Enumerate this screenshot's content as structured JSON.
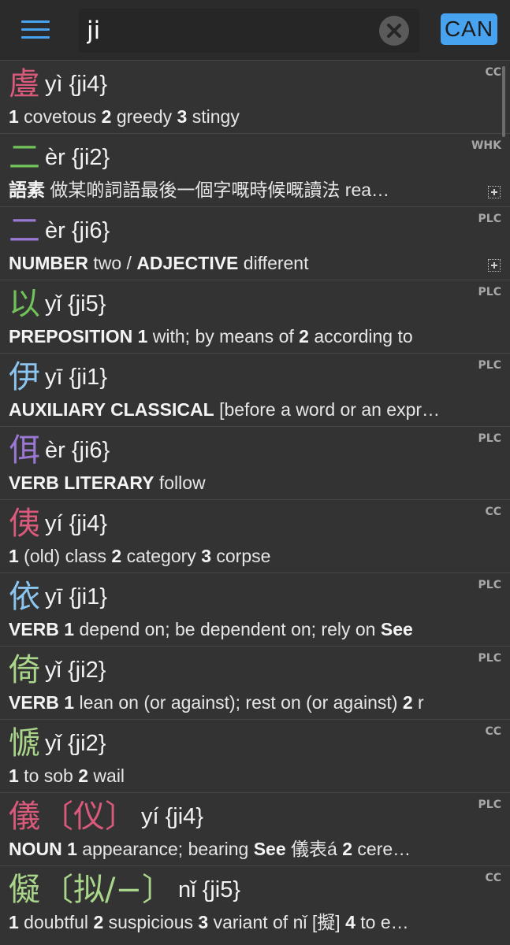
{
  "search": {
    "query": "ji"
  },
  "lang_button": "CAN",
  "results": [
    {
      "char": "䖒",
      "variant": "",
      "romanization": "yì {ji4}",
      "source": "CC",
      "definition": [
        {
          "t": "1",
          "b": true
        },
        {
          "t": " covetous  "
        },
        {
          "t": "2",
          "b": true
        },
        {
          "t": " greedy  "
        },
        {
          "t": "3",
          "b": true
        },
        {
          "t": " stingy"
        }
      ],
      "expandable": false
    },
    {
      "char": "二",
      "variant": "",
      "romanization": "èr {ji2}",
      "source": "WHK",
      "definition": [
        {
          "t": "語素",
          "b": true
        },
        {
          "t": "  做某啲詞語最後一個字嘅時候嘅讀法  rea…"
        }
      ],
      "expandable": true
    },
    {
      "char": "二",
      "variant": "",
      "romanization": "èr {ji6}",
      "source": "PLC",
      "definition": [
        {
          "t": "NUMBER",
          "b": true
        },
        {
          "t": " two /  "
        },
        {
          "t": "ADJECTIVE",
          "b": true
        },
        {
          "t": " different"
        }
      ],
      "expandable": true
    },
    {
      "char": "以",
      "variant": "",
      "romanization": "yǐ {ji5}",
      "source": "PLC",
      "definition": [
        {
          "t": "PREPOSITION",
          "b": true
        },
        {
          "t": "  "
        },
        {
          "t": "1",
          "b": true
        },
        {
          "t": " with; by means of  "
        },
        {
          "t": "2",
          "b": true
        },
        {
          "t": " according to"
        }
      ],
      "expandable": false
    },
    {
      "char": "伊",
      "variant": "",
      "romanization": "yī {ji1}",
      "source": "PLC",
      "definition": [
        {
          "t": "AUXILIARY  CLASSICAL",
          "b": true
        },
        {
          "t": " [before a word or an expr…"
        }
      ],
      "expandable": false
    },
    {
      "char": "佴",
      "variant": "",
      "romanization": "èr {ji6}",
      "source": "PLC",
      "definition": [
        {
          "t": "VERB  LITERARY",
          "b": true
        },
        {
          "t": " follow"
        }
      ],
      "expandable": false
    },
    {
      "char": "侇",
      "variant": "",
      "romanization": "yí {ji4}",
      "source": "CC",
      "definition": [
        {
          "t": "1",
          "b": true
        },
        {
          "t": " (old) class  "
        },
        {
          "t": "2",
          "b": true
        },
        {
          "t": " category  "
        },
        {
          "t": "3",
          "b": true
        },
        {
          "t": " corpse"
        }
      ],
      "expandable": false
    },
    {
      "char": "依",
      "variant": "",
      "romanization": "yī {ji1}",
      "source": "PLC",
      "definition": [
        {
          "t": "VERB",
          "b": true
        },
        {
          "t": "  "
        },
        {
          "t": "1",
          "b": true
        },
        {
          "t": " depend on; be dependent on; rely on "
        },
        {
          "t": "See",
          "b": true
        }
      ],
      "expandable": false
    },
    {
      "char": "倚",
      "variant": "",
      "romanization": "yǐ {ji2}",
      "source": "PLC",
      "definition": [
        {
          "t": "VERB",
          "b": true
        },
        {
          "t": "  "
        },
        {
          "t": "1",
          "b": true
        },
        {
          "t": " lean on (or against); rest on (or against)  "
        },
        {
          "t": "2",
          "b": true
        },
        {
          "t": " r"
        }
      ],
      "expandable": false
    },
    {
      "char": "㥴",
      "variant": "",
      "romanization": "yǐ {ji2}",
      "source": "CC",
      "definition": [
        {
          "t": "1",
          "b": true
        },
        {
          "t": " to sob  "
        },
        {
          "t": "2",
          "b": true
        },
        {
          "t": " wail"
        }
      ],
      "expandable": false
    },
    {
      "char": "儀",
      "variant": "〔仪〕",
      "romanization": "yí {ji4}",
      "source": "PLC",
      "definition": [
        {
          "t": "NOUN",
          "b": true
        },
        {
          "t": "  "
        },
        {
          "t": "1",
          "b": true
        },
        {
          "t": " appearance; bearing "
        },
        {
          "t": "See",
          "b": true
        },
        {
          "t": " 儀表á  "
        },
        {
          "t": "2",
          "b": true
        },
        {
          "t": " cere…"
        }
      ],
      "expandable": false
    },
    {
      "char": "儗",
      "variant": "〔拟/−〕",
      "romanization": "nǐ {ji5}",
      "source": "CC",
      "definition": [
        {
          "t": "1",
          "b": true
        },
        {
          "t": " doubtful  "
        },
        {
          "t": "2",
          "b": true
        },
        {
          "t": " suspicious  "
        },
        {
          "t": "3",
          "b": true
        },
        {
          "t": " variant of nǐ [擬]  "
        },
        {
          "t": "4",
          "b": true
        },
        {
          "t": " to e…"
        }
      ],
      "expandable": false
    }
  ]
}
